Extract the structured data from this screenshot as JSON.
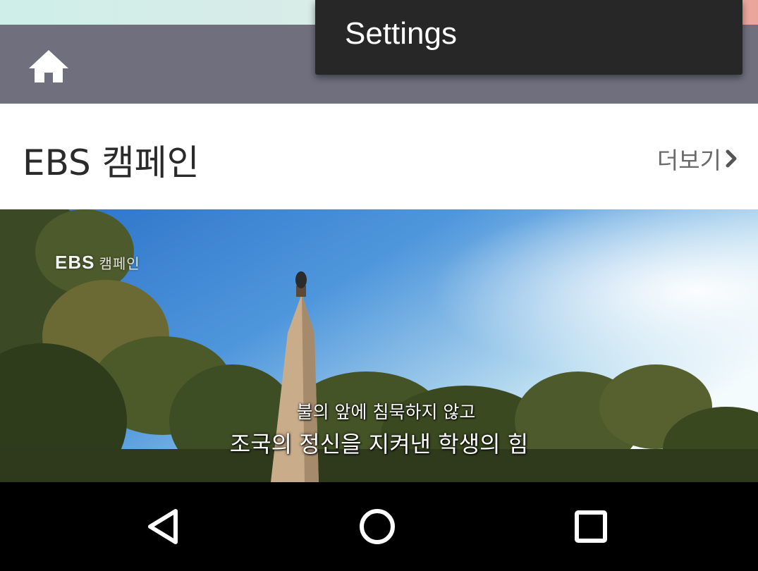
{
  "menu": {
    "items": [
      {
        "label": "Settings"
      }
    ]
  },
  "toolbar": {
    "home_icon": "home-icon"
  },
  "section": {
    "title": "EBS 캠페인",
    "more_label": "더보기"
  },
  "video": {
    "watermark": "EBS",
    "watermark_sub": "캠페인",
    "caption_line1": "불의 앞에 침묵하지 않고",
    "caption_line2": "조국의 정신을 지켜낸 학생의 힘"
  },
  "navbar": {
    "back_icon": "back-triangle-icon",
    "home_icon": "home-circle-icon",
    "recents_icon": "recents-square-icon"
  },
  "colors": {
    "toolbar": "#6f6f7e",
    "menu_bg": "#272727",
    "navbar": "#000000"
  }
}
